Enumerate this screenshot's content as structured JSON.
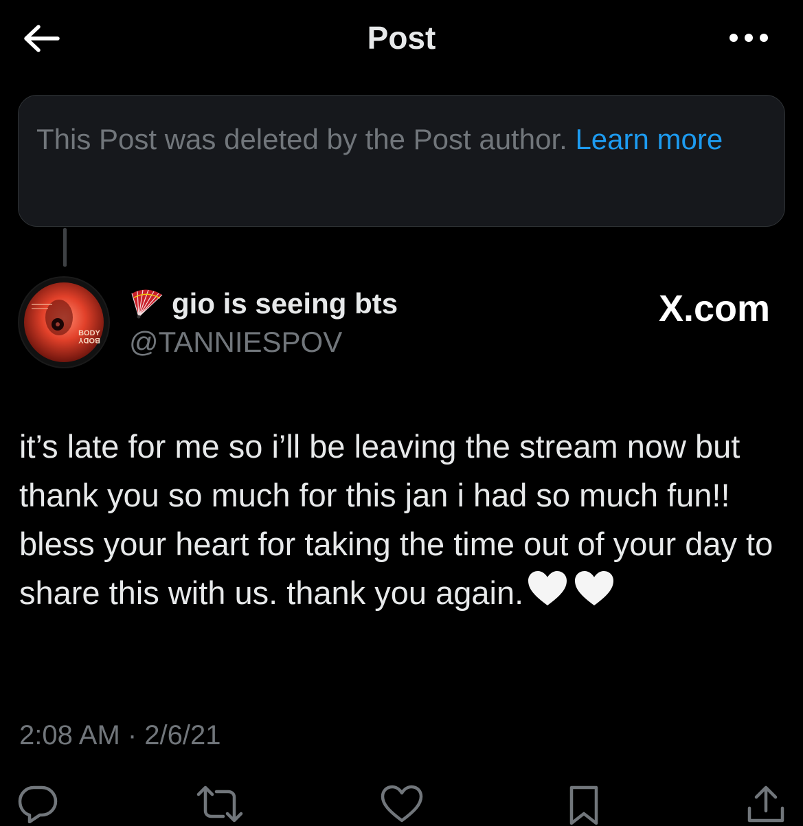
{
  "header": {
    "title": "Post",
    "back_icon": "arrow-left-icon",
    "more_icon": "more-horizontal-icon"
  },
  "deleted_notice": {
    "text": "This Post was deleted by the Post author. ",
    "link": "Learn more"
  },
  "author": {
    "display_name": "gio is seeing bts",
    "name_emoji_icon": "folding-fan-icon",
    "handle": "@TANNIESPOV",
    "avatar_text": "BODY"
  },
  "brand": {
    "label": "X.com"
  },
  "post": {
    "text": "it’s late for me so i’ll be leaving the stream now but thank you so much for this jan i had so much fun!! bless your heart for taking the time out of your day to share this with us. thank you again.",
    "emoji_icons": [
      "white-heart-icon",
      "white-heart-icon"
    ],
    "timestamp": "2:08 AM · 2/6/21"
  },
  "actions": {
    "reply_icon": "reply-icon",
    "repost_icon": "repost-icon",
    "like_icon": "heart-icon",
    "bookmark_icon": "bookmark-icon",
    "share_icon": "share-icon"
  },
  "colors": {
    "background": "#000000",
    "text": "#e7e9ea",
    "muted": "#71767b",
    "link": "#1d9bf0",
    "notice_bg": "#16181c",
    "border": "#2f3336"
  }
}
